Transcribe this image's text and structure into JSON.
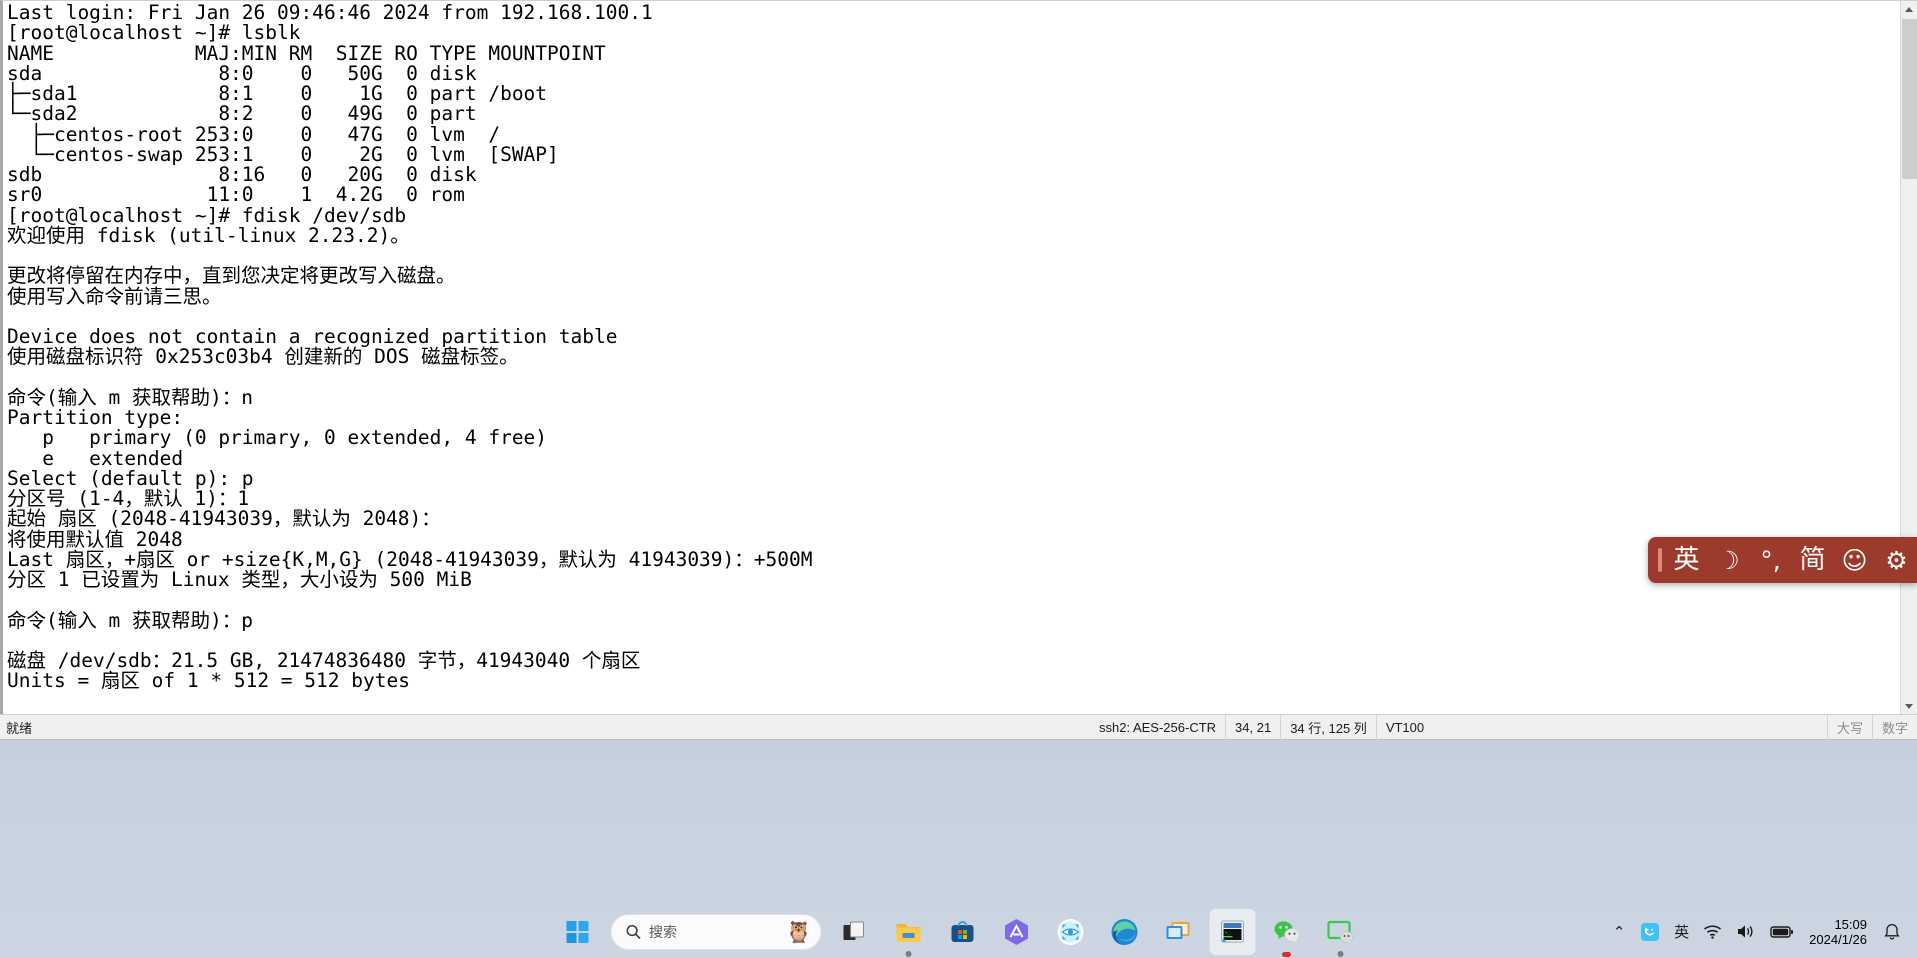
{
  "terminal": {
    "lines": [
      "Last login: Fri Jan 26 09:46:46 2024 from 192.168.100.1",
      "[root@localhost ~]# lsblk",
      "NAME            MAJ:MIN RM  SIZE RO TYPE MOUNTPOINT",
      "sda               8:0    0   50G  0 disk ",
      "├─sda1            8:1    0    1G  0 part /boot",
      "└─sda2            8:2    0   49G  0 part ",
      "  ├─centos-root 253:0    0   47G  0 lvm  /",
      "  └─centos-swap 253:1    0    2G  0 lvm  [SWAP]",
      "sdb               8:16   0   20G  0 disk ",
      "sr0              11:0    1  4.2G  0 rom  ",
      "[root@localhost ~]# fdisk /dev/sdb",
      "欢迎使用 fdisk (util-linux 2.23.2)。",
      "",
      "更改将停留在内存中，直到您决定将更改写入磁盘。",
      "使用写入命令前请三思。",
      "",
      "Device does not contain a recognized partition table",
      "使用磁盘标识符 0x253c03b4 创建新的 DOS 磁盘标签。",
      "",
      "命令(输入 m 获取帮助)：n",
      "Partition type:",
      "   p   primary (0 primary, 0 extended, 4 free)",
      "   e   extended",
      "Select (default p): p",
      "分区号 (1-4，默认 1)：1",
      "起始 扇区 (2048-41943039，默认为 2048)：",
      "将使用默认值 2048",
      "Last 扇区，+扇区 or +size{K,M,G} (2048-41943039，默认为 41943039)：+500M",
      "分区 1 已设置为 Linux 类型，大小设为 500 MiB",
      "",
      "命令(输入 m 获取帮助)：p",
      "",
      "磁盘 /dev/sdb：21.5 GB, 21474836480 字节，41943040 个扇区",
      "Units = 扇区 of 1 * 512 = 512 bytes"
    ]
  },
  "ime": {
    "items": [
      {
        "name": "english-mode",
        "glyph": "英"
      },
      {
        "name": "moon-mode-icon",
        "glyph": "☽"
      },
      {
        "name": "punctuation-icon",
        "glyph": "°,"
      },
      {
        "name": "simplified-chinese",
        "glyph": "简"
      },
      {
        "name": "emoji-icon",
        "glyph": "☺"
      },
      {
        "name": "settings-gear-icon",
        "glyph": "⚙"
      }
    ],
    "bar_color": "#9c3a2b"
  },
  "statusbar": {
    "ready": "就绪",
    "cipher": "ssh2: AES-256-CTR",
    "cursor": "34, 21",
    "dimensions": "34 行, 125 列",
    "emulation": "VT100",
    "caps": "大写",
    "num": "数字"
  },
  "taskbar": {
    "search_placeholder": "搜索",
    "icons": [
      {
        "name": "start-button-icon",
        "label": "Start"
      },
      {
        "name": "task-view-icon",
        "label": "Task View"
      },
      {
        "name": "file-explorer-icon",
        "label": "File Explorer"
      },
      {
        "name": "microsoft-store-icon",
        "label": "Microsoft Store"
      },
      {
        "name": "app-purple-icon",
        "label": "App"
      },
      {
        "name": "eye-scan-icon",
        "label": "Eye"
      },
      {
        "name": "microsoft-edge-icon",
        "label": "Microsoft Edge"
      },
      {
        "name": "remote-desktop-icon",
        "label": "Remote Desktop"
      },
      {
        "name": "xshell-terminal-icon",
        "label": "Terminal"
      },
      {
        "name": "wechat-icon",
        "label": "WeChat"
      },
      {
        "name": "screen-share-icon",
        "label": "Screen Share"
      }
    ],
    "tray": {
      "chevron": "⌃",
      "ime_indicator": "英",
      "clock_time": "15:09",
      "clock_date": "2024/1/26"
    }
  }
}
